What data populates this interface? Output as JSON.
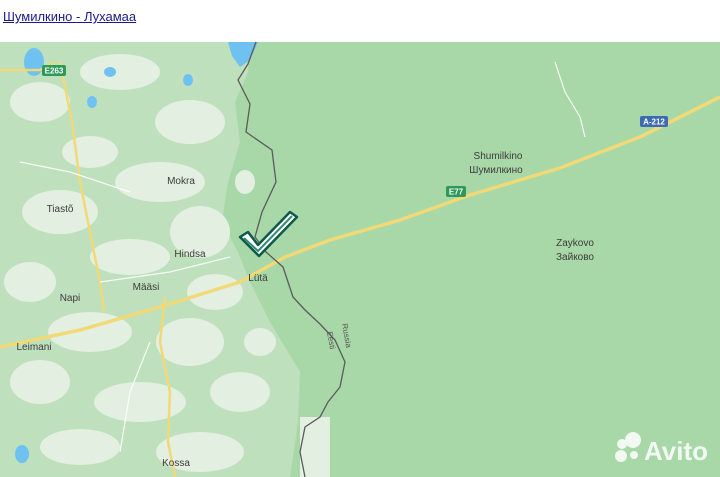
{
  "page": {
    "route_link": "Шумилкино - Лухамаа"
  },
  "map": {
    "road_shields": {
      "e263": "E263",
      "e77": "E77",
      "a212": "A-212"
    },
    "places": {
      "shumilkino_lat": "Shumilkino",
      "shumilkino_cyr": "Шумилкино",
      "zaykovo_lat": "Zaykovo",
      "zaykovo_cyr": "Зайково",
      "mokra": "Mokra",
      "tiasto": "Tiastõ",
      "hindsa": "Hindsa",
      "luta": "Lütä",
      "maasi": "Määsi",
      "napi": "Napi",
      "leimani": "Leimani",
      "kossa": "Kossa"
    },
    "border_labels": {
      "russia": "Russia",
      "eesti": "Eesti"
    },
    "marker_icon": "checkmark-icon",
    "colors": {
      "land": "#a8d7a8",
      "forest_light": "#dcecd9",
      "water": "#6ec1f0",
      "road": "#f1d977",
      "border": "#5b5b5b",
      "marker": "#0e5a4a"
    }
  },
  "watermark": {
    "brand": "Avito"
  }
}
